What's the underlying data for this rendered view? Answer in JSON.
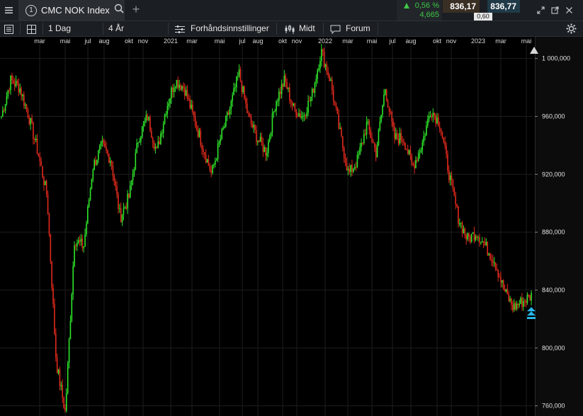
{
  "window": {
    "tab_number": "1",
    "instrument": "CMC NOK Index",
    "change_pct": "0,56 %",
    "change_abs": "4,665",
    "sell_price": "836,17",
    "buy_price": "836,77",
    "spread": "0,60"
  },
  "toolbar": {
    "interval": "1 Dag",
    "range": "4 År",
    "settings": "Forhåndsinnstillinger",
    "price_mode": "Midt",
    "forum": "Forum"
  },
  "icons": [
    "menu-icon",
    "search-icon",
    "plus-icon",
    "expand-icon",
    "popout-icon",
    "close-icon",
    "list-icon",
    "layout-icon",
    "sliders-icon",
    "candles-icon",
    "chat-icon",
    "gear-icon"
  ],
  "colors": {
    "up": "#2ee62a",
    "down": "#e02a1c",
    "background": "#000000",
    "grid": "#1e1e1e",
    "marker": "#27b6e6"
  },
  "chart_data": {
    "type": "candlestick",
    "x_labels": [
      "mar",
      "mai",
      "jul",
      "aug",
      "okt",
      "nov",
      "2021",
      "mar",
      "mai",
      "jul",
      "aug",
      "okt",
      "nov",
      "2022",
      "mar",
      "mai",
      "jul",
      "aug",
      "okt",
      "nov",
      "2023",
      "mar",
      "mai"
    ],
    "y_ticks": [
      "1 000,000",
      "960,000",
      "920,000",
      "880,000",
      "840,000",
      "800,000",
      "760,000"
    ],
    "ylim": [
      753,
      1015
    ],
    "grid": true,
    "series": [
      {
        "values": [
          960,
          985,
          980,
          960,
          935,
          905,
          790,
          755,
          875,
          870,
          925,
          940,
          930,
          890,
          905,
          945,
          960,
          935,
          965,
          985,
          980,
          960,
          940,
          920,
          945,
          965,
          990,
          960,
          945,
          935,
          970,
          985,
          965,
          960,
          975,
          1005,
          985,
          950,
          920,
          930,
          955,
          935,
          980,
          945,
          945,
          925,
          940,
          965,
          955,
          920,
          890,
          875,
          880,
          870,
          860,
          840,
          828,
          832,
          836
        ]
      }
    ]
  }
}
